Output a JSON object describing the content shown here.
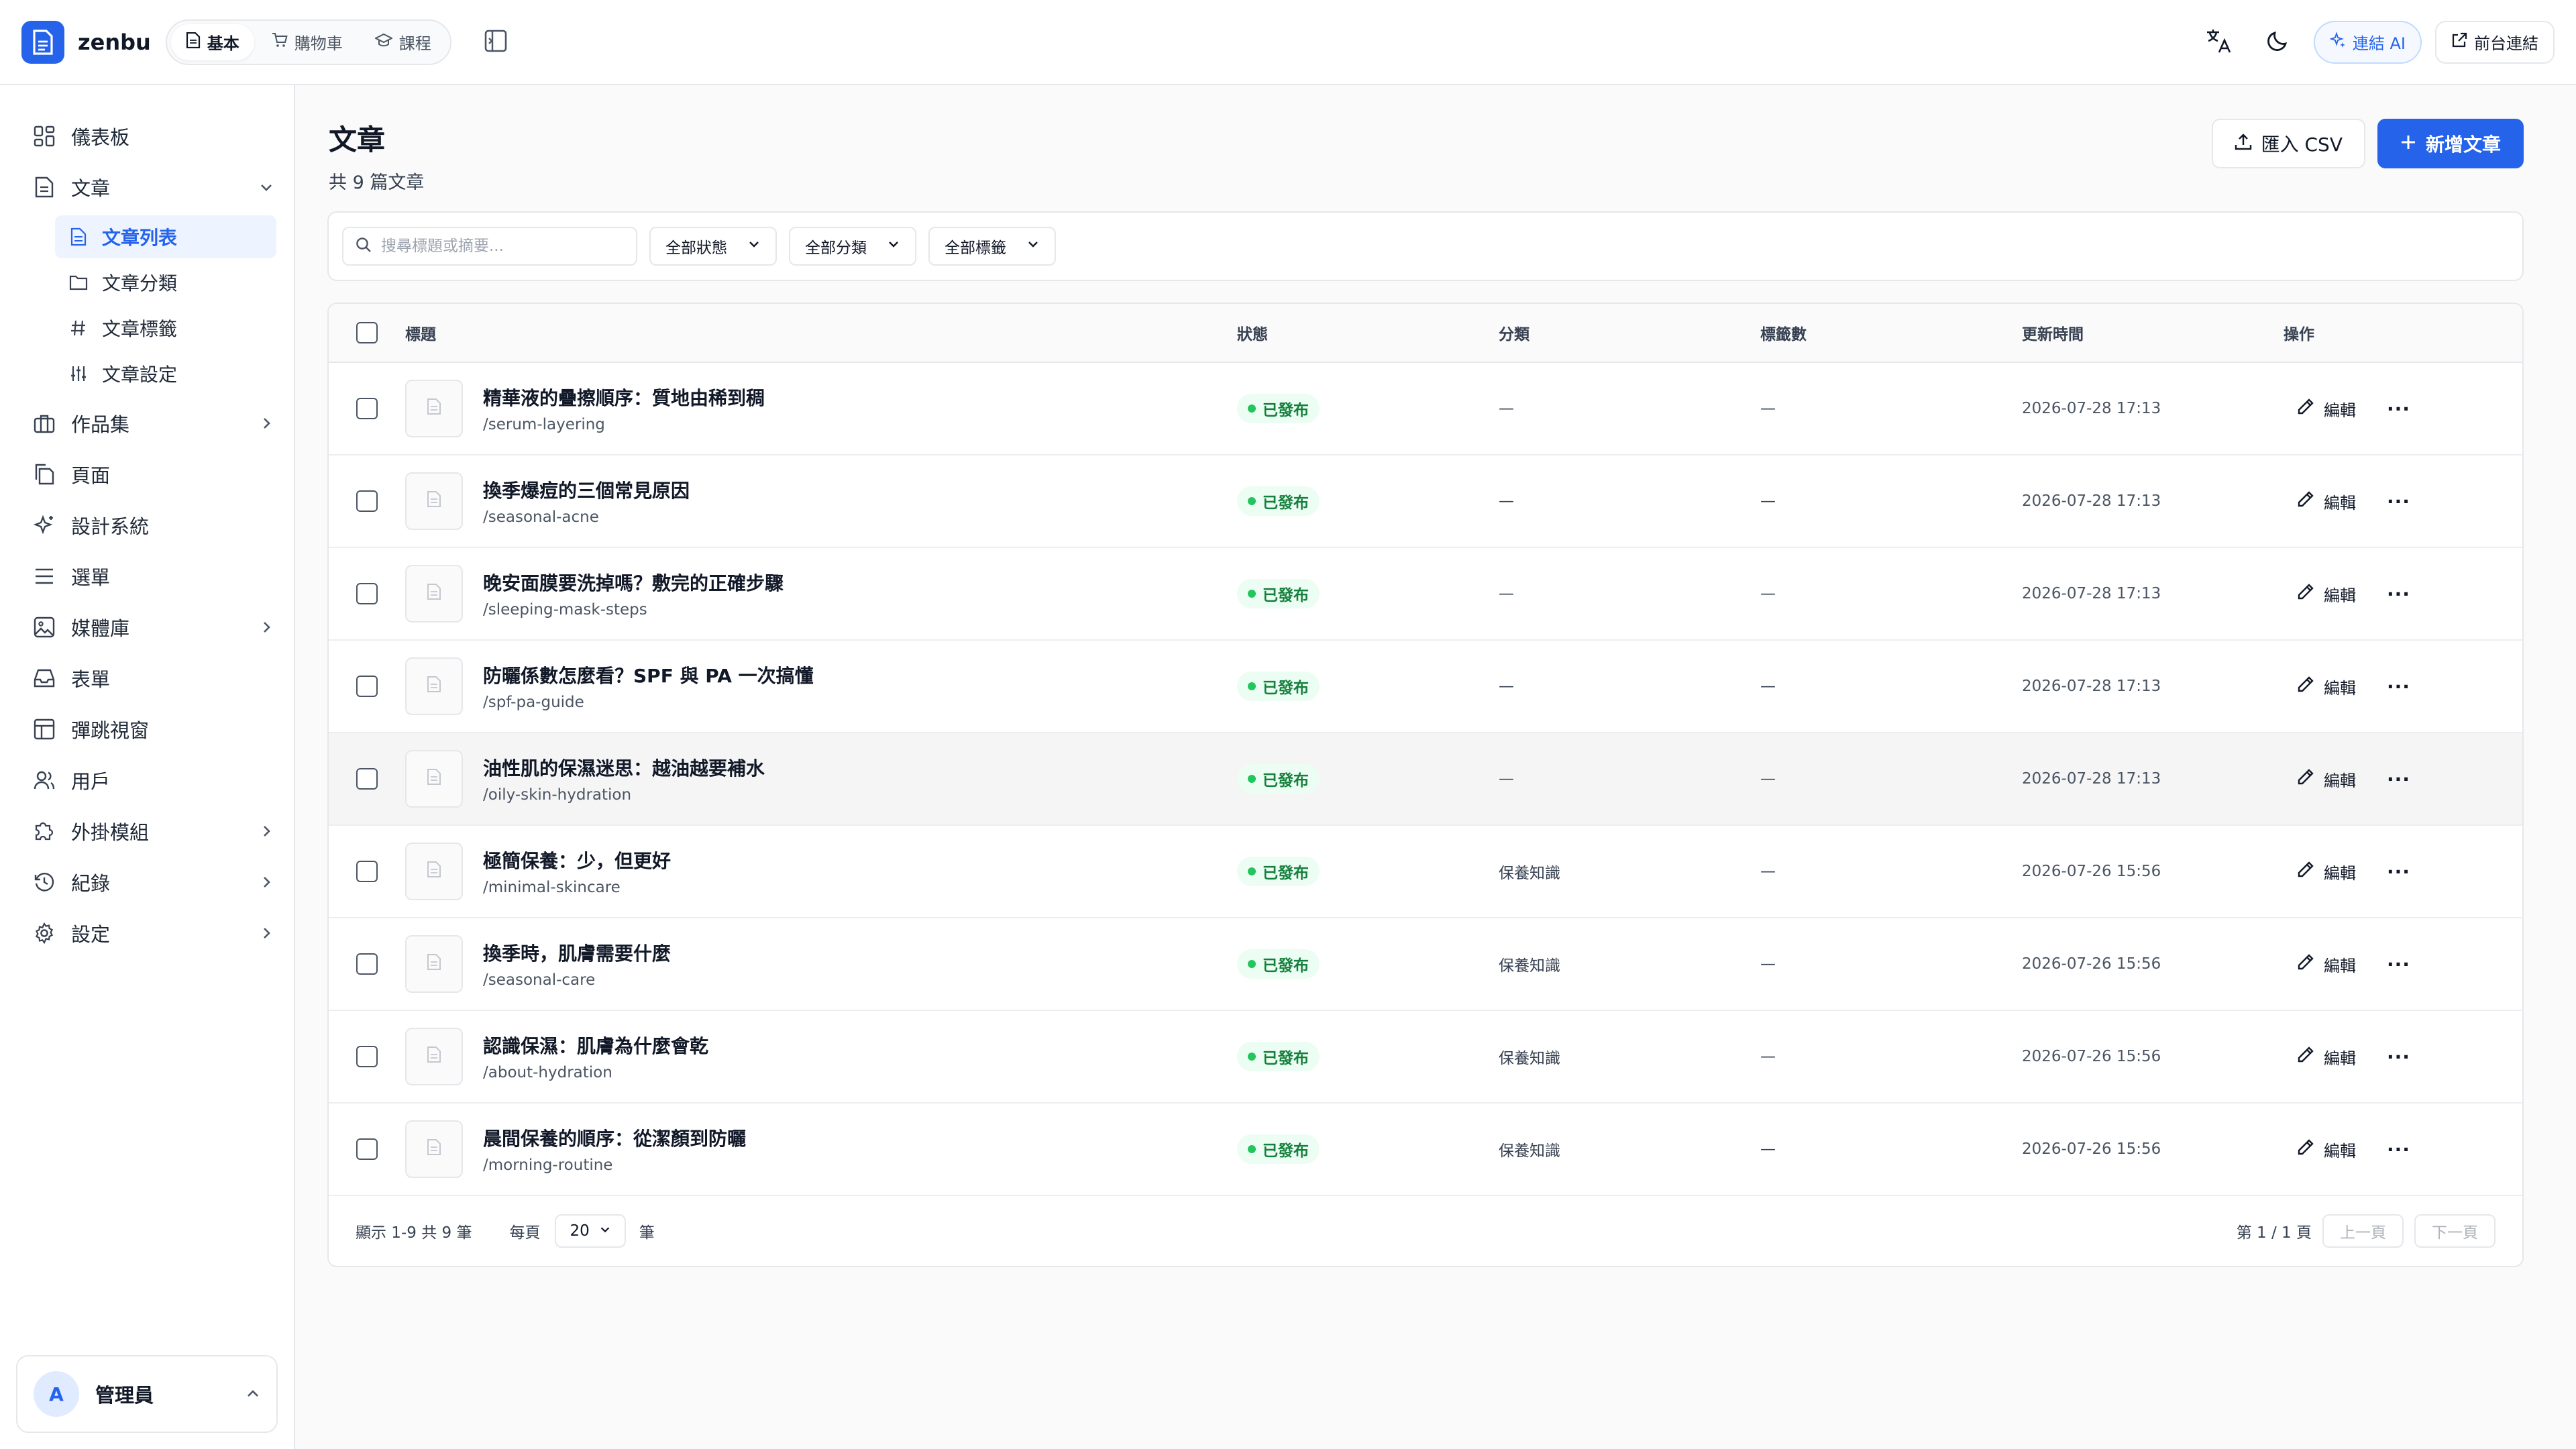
{
  "app": {
    "brand": "zenbu"
  },
  "header": {
    "modes": [
      {
        "label": "基本",
        "icon": "document-icon",
        "active": true
      },
      {
        "label": "購物車",
        "icon": "cart-icon",
        "active": false
      },
      {
        "label": "課程",
        "icon": "graduation-cap-icon",
        "active": false
      }
    ],
    "ai_label": "連結 AI",
    "frontend_label": "前台連結"
  },
  "sidebar": {
    "items": [
      {
        "label": "儀表板",
        "icon": "dashboard-icon"
      },
      {
        "label": "文章",
        "icon": "document-icon",
        "expanded": true
      },
      {
        "label": "作品集",
        "icon": "briefcase-icon"
      },
      {
        "label": "頁面",
        "icon": "pages-icon"
      },
      {
        "label": "設計系統",
        "icon": "sparkles-icon"
      },
      {
        "label": "選單",
        "icon": "menu-icon"
      },
      {
        "label": "媒體庫",
        "icon": "image-icon"
      },
      {
        "label": "表單",
        "icon": "inbox-icon"
      },
      {
        "label": "彈跳視窗",
        "icon": "layout-icon"
      },
      {
        "label": "用戶",
        "icon": "users-icon"
      },
      {
        "label": "外掛模組",
        "icon": "puzzle-icon"
      },
      {
        "label": "紀錄",
        "icon": "history-icon"
      },
      {
        "label": "設定",
        "icon": "gear-icon"
      }
    ],
    "sub_items": [
      {
        "label": "文章列表",
        "icon": "document-icon",
        "active": true
      },
      {
        "label": "文章分類",
        "icon": "folder-icon",
        "active": false
      },
      {
        "label": "文章標籤",
        "icon": "hash-icon",
        "active": false
      },
      {
        "label": "文章設定",
        "icon": "sliders-icon",
        "active": false
      }
    ],
    "user": {
      "initial": "A",
      "name": "管理員"
    }
  },
  "page": {
    "title": "文章",
    "subtitle": "共 9 篇文章",
    "import_label": "匯入 CSV",
    "new_label": "新增文章"
  },
  "filters": {
    "search_placeholder": "搜尋標題或摘要...",
    "status": "全部狀態",
    "category": "全部分類",
    "tag": "全部標籤"
  },
  "table": {
    "headers": {
      "title": "標題",
      "status": "狀態",
      "category": "分類",
      "tags": "標籤數",
      "updated": "更新時間",
      "actions": "操作"
    },
    "edit_label": "編輯",
    "more_label": "···",
    "rows": [
      {
        "title": "精華液的疊擦順序：質地由稀到稠",
        "slug": "/serum-layering",
        "status": "已發布",
        "category": "—",
        "tags": "—",
        "updated": "2026-07-28 17:13"
      },
      {
        "title": "換季爆痘的三個常見原因",
        "slug": "/seasonal-acne",
        "status": "已發布",
        "category": "—",
        "tags": "—",
        "updated": "2026-07-28 17:13"
      },
      {
        "title": "晚安面膜要洗掉嗎？敷完的正確步驟",
        "slug": "/sleeping-mask-steps",
        "status": "已發布",
        "category": "—",
        "tags": "—",
        "updated": "2026-07-28 17:13"
      },
      {
        "title": "防曬係數怎麼看？SPF 與 PA 一次搞懂",
        "slug": "/spf-pa-guide",
        "status": "已發布",
        "category": "—",
        "tags": "—",
        "updated": "2026-07-28 17:13"
      },
      {
        "title": "油性肌的保濕迷思：越油越要補水",
        "slug": "/oily-skin-hydration",
        "status": "已發布",
        "category": "—",
        "tags": "—",
        "updated": "2026-07-28 17:13"
      },
      {
        "title": "極簡保養：少，但更好",
        "slug": "/minimal-skincare",
        "status": "已發布",
        "category": "保養知識",
        "tags": "—",
        "updated": "2026-07-26 15:56"
      },
      {
        "title": "換季時，肌膚需要什麼",
        "slug": "/seasonal-care",
        "status": "已發布",
        "category": "保養知識",
        "tags": "—",
        "updated": "2026-07-26 15:56"
      },
      {
        "title": "認識保濕：肌膚為什麼會乾",
        "slug": "/about-hydration",
        "status": "已發布",
        "category": "保養知識",
        "tags": "—",
        "updated": "2026-07-26 15:56"
      },
      {
        "title": "晨間保養的順序：從潔顏到防曬",
        "slug": "/morning-routine",
        "status": "已發布",
        "category": "保養知識",
        "tags": "—",
        "updated": "2026-07-26 15:56"
      }
    ]
  },
  "footer": {
    "showing": "顯示 1-9 共 9 筆",
    "per_page_label": "每頁",
    "per_page_value": "20",
    "per_page_unit": "筆",
    "page_info": "第 1 / 1 頁",
    "prev": "上一頁",
    "next": "下一頁"
  },
  "colors": {
    "accent": "#2563eb",
    "success": "#15803d",
    "border": "#e5e7eb"
  }
}
